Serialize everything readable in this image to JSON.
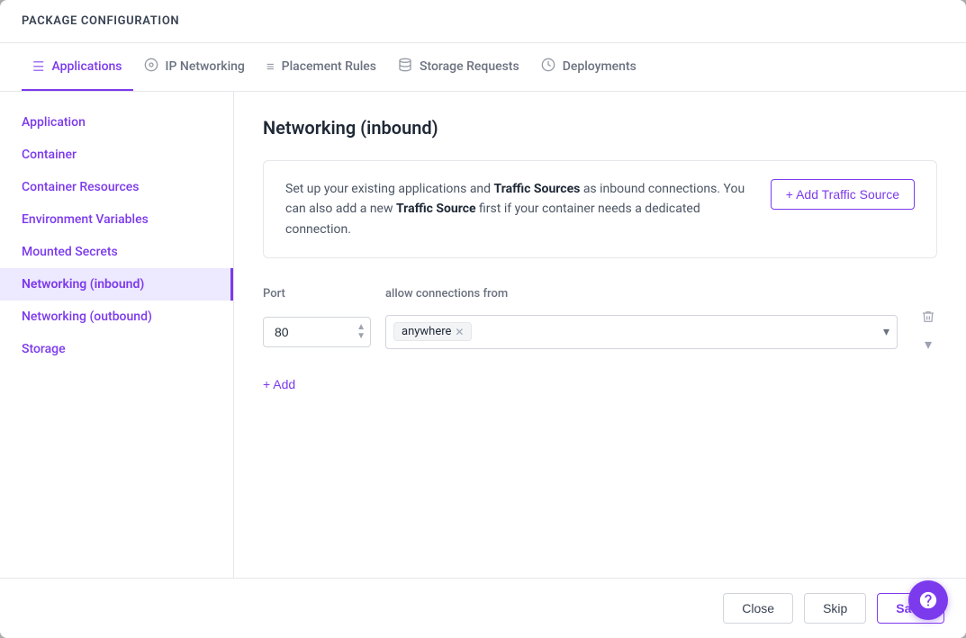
{
  "header": {
    "title": "PACKAGE CONFIGURATION"
  },
  "tabs": [
    {
      "id": "applications",
      "label": "Applications",
      "icon": "☰",
      "active": true
    },
    {
      "id": "ip-networking",
      "label": "IP Networking",
      "icon": "⊙"
    },
    {
      "id": "placement-rules",
      "label": "Placement Rules",
      "icon": "≡"
    },
    {
      "id": "storage-requests",
      "label": "Storage Requests",
      "icon": "⬜"
    },
    {
      "id": "deployments",
      "label": "Deployments",
      "icon": "⏱"
    }
  ],
  "sidebar": {
    "items": [
      {
        "id": "application",
        "label": "Application"
      },
      {
        "id": "container",
        "label": "Container"
      },
      {
        "id": "container-resources",
        "label": "Container Resources"
      },
      {
        "id": "environment-variables",
        "label": "Environment Variables"
      },
      {
        "id": "mounted-secrets",
        "label": "Mounted Secrets"
      },
      {
        "id": "networking-inbound",
        "label": "Networking (inbound)",
        "active": true
      },
      {
        "id": "networking-outbound",
        "label": "Networking (outbound)"
      },
      {
        "id": "storage",
        "label": "Storage"
      }
    ]
  },
  "content": {
    "section_title": "Networking (inbound)",
    "info_text_1": "Set up your existing applications and ",
    "info_bold_1": "Traffic Sources",
    "info_text_2": " as inbound connections. You can also add a new ",
    "info_bold_2": "Traffic Source",
    "info_text_3": " first if your container needs a dedicated connection.",
    "add_traffic_source_label": "+ Add Traffic Source",
    "port_label": "Port",
    "connections_label": "allow connections from",
    "port_value": "80",
    "tag_value": "anywhere",
    "add_row_label": "+ Add"
  },
  "footer": {
    "close_label": "Close",
    "skip_label": "Skip",
    "save_label": "Save"
  },
  "help": {
    "icon": "help-circle"
  }
}
